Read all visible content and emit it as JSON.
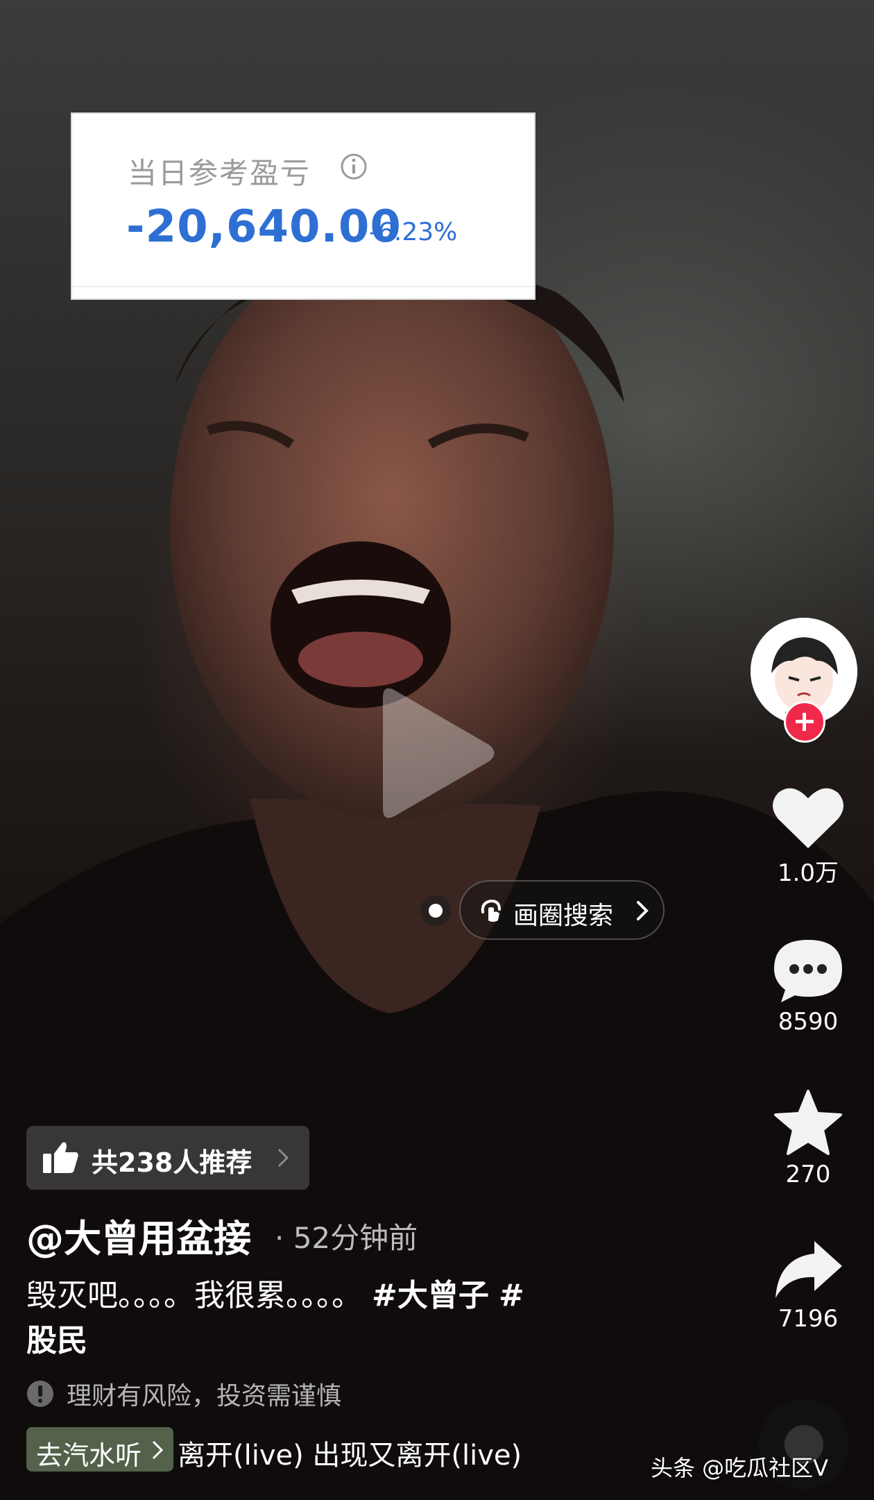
{
  "overlay_card": {
    "label": "当日参考盈亏",
    "amount": "-20,640.00",
    "percent": "-6.23%"
  },
  "circle_search": {
    "label": "画圈搜索"
  },
  "side_actions": {
    "likes": "1.0万",
    "comments": "8590",
    "favorites": "270",
    "shares": "7196"
  },
  "recommend": {
    "label": "共238人推荐"
  },
  "post": {
    "author": "@大曾用盆接",
    "time_ago": "· 52分钟前",
    "caption_text": "毁灭吧。。。。我很累。。。。",
    "tag1": "#大曾子",
    "tag2": "#",
    "tag2_cont": "股民"
  },
  "risk_notice": "理财有风险，投资需谨慎",
  "music": {
    "entry_label": "去汽水听",
    "track": "离开(live)    出现又离开(live)"
  },
  "watermark": "头条 @吃瓜社区V",
  "colors": {
    "amount_blue": "#2e6fd4",
    "follow_red": "#f0284a"
  }
}
